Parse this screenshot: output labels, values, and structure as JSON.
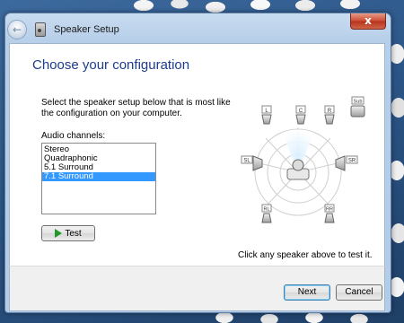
{
  "window": {
    "title": "Speaker Setup",
    "close_glyph": "x"
  },
  "page": {
    "heading": "Choose your configuration",
    "instructions": "Select the speaker setup below that is most like the configuration on your computer.",
    "audio_channels_label": "Audio channels:"
  },
  "channels": {
    "items": [
      "Stereo",
      "Quadraphonic",
      "5.1 Surround",
      "7.1 Surround"
    ],
    "selected": "7.1 Surround"
  },
  "test_button": {
    "label": "Test",
    "icon": "play-icon"
  },
  "speakers": {
    "labels": [
      "L",
      "C",
      "R",
      "Sub",
      "SL",
      "SR",
      "RL",
      "RR"
    ]
  },
  "hint": "Click any speaker above to test it.",
  "footer": {
    "next_label": "Next",
    "cancel_label": "Cancel"
  },
  "colors": {
    "heading": "#1e3c8c",
    "selection": "#3399ff",
    "play": "#1f9a2a"
  }
}
